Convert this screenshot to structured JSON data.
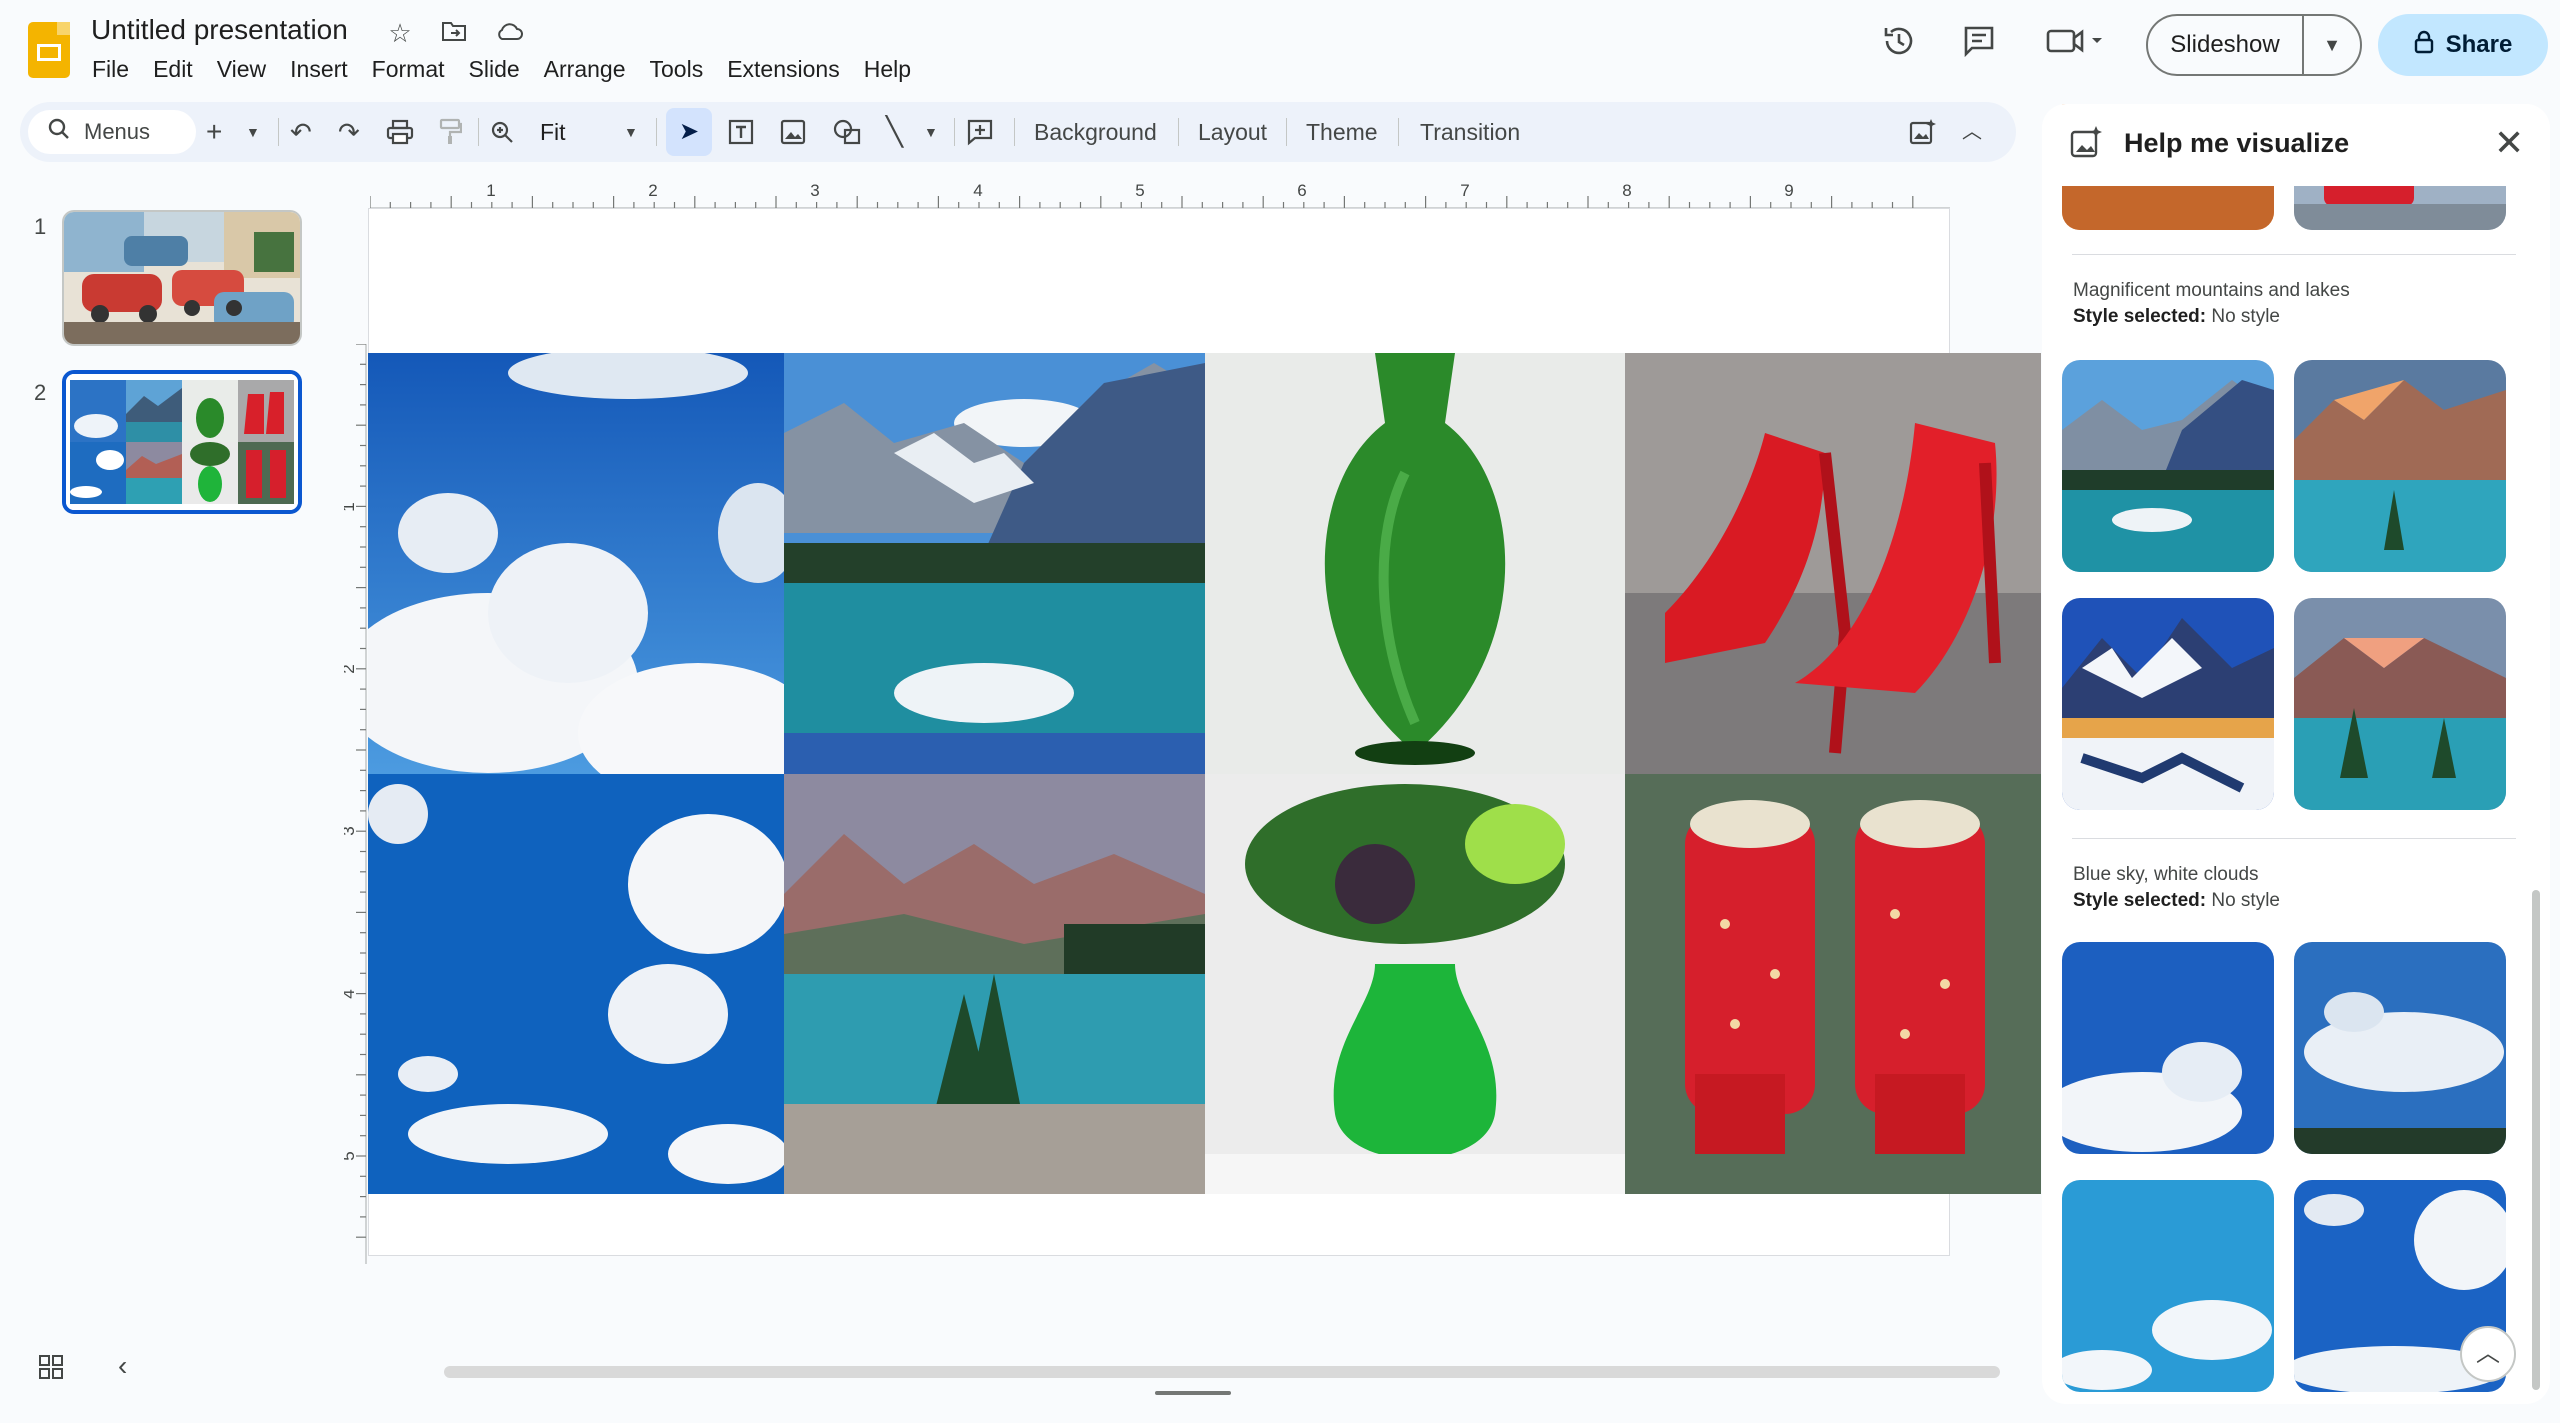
{
  "app": {
    "title": "Untitled presentation",
    "menu": [
      "File",
      "Edit",
      "View",
      "Insert",
      "Format",
      "Slide",
      "Arrange",
      "Tools",
      "Extensions",
      "Help"
    ],
    "slideshow_label": "Slideshow",
    "share_label": "Share"
  },
  "toolbar": {
    "menus_label": "Menus",
    "zoom_label": "Fit",
    "background_label": "Background",
    "layout_label": "Layout",
    "theme_label": "Theme",
    "transition_label": "Transition"
  },
  "filmstrip": {
    "slides": [
      {
        "number": "1",
        "selected": false
      },
      {
        "number": "2",
        "selected": true
      }
    ]
  },
  "ruler": {
    "horizontal_labels": [
      "1",
      "2",
      "3",
      "4",
      "5",
      "6",
      "7",
      "8",
      "9"
    ],
    "vertical_labels": [
      "1",
      "2",
      "3",
      "4",
      "5"
    ]
  },
  "slide_images": [
    "blue-sky-clouds",
    "mountain-lake",
    "green-vase",
    "red-stiletto-boots",
    "blue-sky-clouds",
    "mountain-lake-trees",
    "green-vase-plant",
    "red-embroidered-boots"
  ],
  "panel": {
    "title": "Help me visualize",
    "groups": [
      {
        "prompt": "Magnificent mountains and lakes",
        "style_label": "Style selected:",
        "style_value": "No style"
      },
      {
        "prompt": "Blue sky, white clouds",
        "style_label": "Style selected:",
        "style_value": "No style"
      }
    ]
  },
  "colors": {
    "accent_blue": "#0b57d0",
    "share_bg": "#c2e7ff",
    "toolbar_bg": "#edf2fa",
    "slides_yellow": "#f4b400"
  },
  "icons": [
    "star-icon",
    "move-folder-icon",
    "cloud-status-icon",
    "history-icon",
    "comment-icon",
    "meet-icon",
    "lock-icon",
    "search-icon",
    "help-me-visualize-icon",
    "close-icon",
    "chevron-up-icon",
    "grid-view-icon",
    "collapse-icon"
  ]
}
